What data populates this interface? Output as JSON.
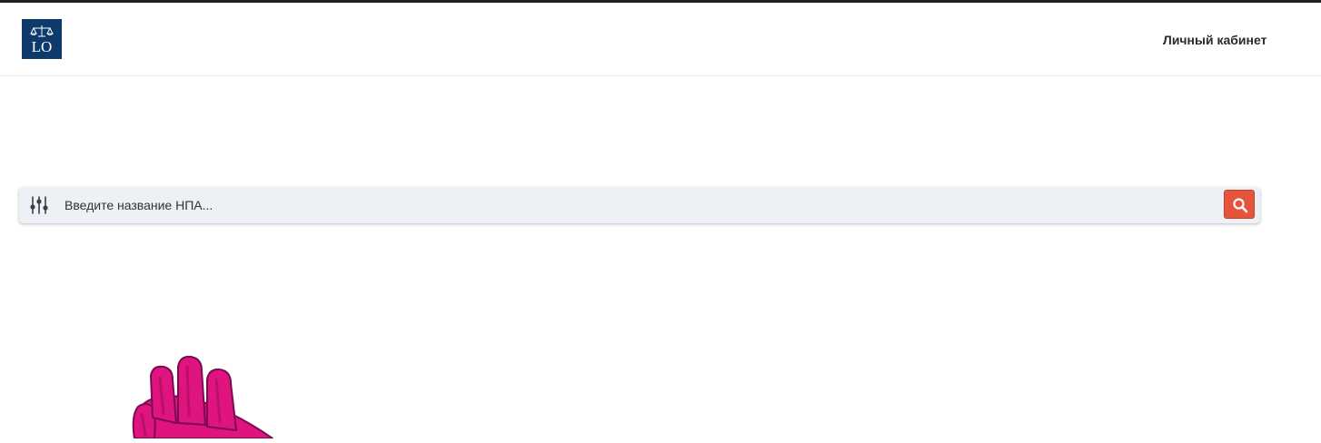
{
  "header": {
    "logo": {
      "text": "LO",
      "icon": "scales-icon",
      "color": "#0d3a6b"
    },
    "account_label": "Личный кабинет"
  },
  "search": {
    "placeholder": "Введите название НПА...",
    "value": "",
    "filter_icon": "sliders-icon",
    "submit_icon": "search-icon",
    "submit_color": "#e4553b"
  },
  "illustration": {
    "icon": "waving-hand-icon",
    "color": "#e0147f"
  }
}
